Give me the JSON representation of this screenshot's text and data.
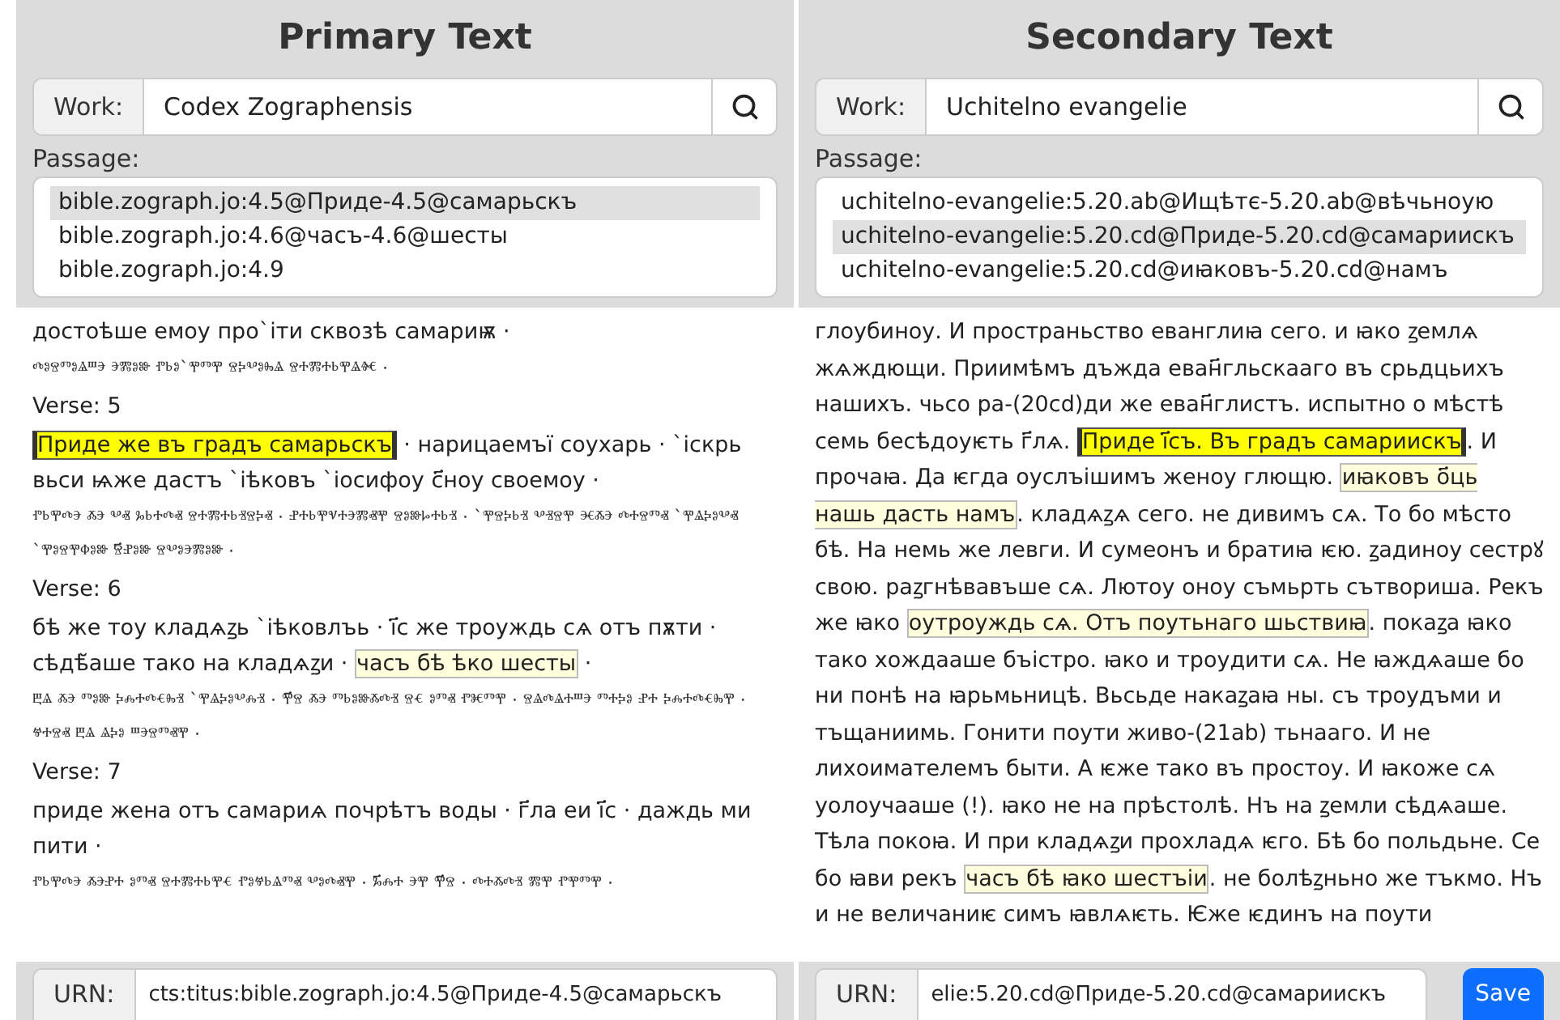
{
  "panels": [
    {
      "title": "Primary Text",
      "work": {
        "label": "Work:",
        "value": "Codex Zographensis"
      },
      "passage": {
        "label": "Passage:",
        "options": [
          {
            "text": "bible.zograph.jo:4.5@Приде-4.5@самарьскъ",
            "selected": true
          },
          {
            "text": "bible.zograph.jo:4.6@часъ-4.6@шесты",
            "selected": false
          },
          {
            "text": "bible.zograph.jo:4.9",
            "selected": false
          }
        ]
      },
      "content": [
        {
          "kind": "cyrillic",
          "segments": [
            {
              "text": "достоѣше емоу про`іти сквозѣ самариѭ ·",
              "kind": "plain"
            }
          ]
        },
        {
          "kind": "glagolitic",
          "text": "ⰴⱁⱄⱅⱁⱑⱎⰵ ⰵⰿⱁⱆ ⱂⱃⱁ`ⰹⱅⰹ ⱄⰽⰲⱁⰸⱑ ⱄⰰⰿⰰⱃⰹⱑⱙ ·"
        },
        {
          "kind": "verse_label",
          "text": "Verse: 5"
        },
        {
          "kind": "cyrillic",
          "segments": [
            {
              "text": "Приде же въ градъ самарьскъ",
              "kind": "strong"
            },
            {
              "text": " · нарицаемъї соухарь · ˋіскрь вьси ѩже дастъ ˋіѣковъ ˋіосифоу с҃ноу своемоу ·",
              "kind": "plain"
            }
          ]
        },
        {
          "kind": "glagolitic",
          "text": "ⱂⱃⰹⰴⰵ ⰶⰵ ⰲⱏ ⰳⱃⰰⰴⱏ ⱄⰰⰿⰰⱃⱐⱄⰽⱏ · ⱀⰰⱃⰹⱌⰰⰵⰿⱏⰹ ⱄⱁⱆⱈⰰⱃⱐ · ˋⰹⱄⰽⱃⱐ ⰲⱐⱄⰹ ⱗⰶⰵ ⰴⰰⱄⱅⱏ ˋⰹⱑⰽⱁⰲⱏ ˋⰹⱁⱄⰹⱇⱁⱆ ⱄ҃ⱀⱁⱆ ⱄⰲⱁⰵⰿⱁⱆ ·"
        },
        {
          "kind": "verse_label",
          "text": "Verse: 6"
        },
        {
          "kind": "cyrillic",
          "segments": [
            {
              "text": "бѣ же тоу кладѧꙁь ˋіѣковлъь · і҃с же троуждь сѧ отъ пѫти · сѣдѣ̆аше тако на кладѧꙁи · ",
              "kind": "plain"
            },
            {
              "text": "часъ бѣ ѣко шесты",
              "kind": "light"
            },
            {
              "text": " ·",
              "kind": "plain"
            }
          ]
        },
        {
          "kind": "glagolitic",
          "text": "ⰱⱑ ⰶⰵ ⱅⱁⱆ ⰽⰾⰰⰴⱔⰸⱐ ˋⰹⱑⰽⱁⰲⰾⱐ · ⰹ҃ⱄ ⰶⰵ ⱅⱃⱁⱆⰶⰴⱐ ⱄⱔ ⱁⱅⱏ ⱂⱘⱅⰹ · ⱄⱑⰴⱑⰰⱎⰵ ⱅⰰⰽⱁ ⱀⰰ ⰽⰾⰰⰴⱔⰸⰹ · ⱍⰰⱄⱏ ⰱⱑ ⱑⰽⱁ ⱎⰵⱄⱅⱏⰹ ·"
        },
        {
          "kind": "verse_label",
          "text": "Verse: 7"
        },
        {
          "kind": "cyrillic",
          "segments": [
            {
              "text": "приде жена отъ самариѧ почрѣтъ воды · г҃ла еи і҃с · даждь ми пити ·",
              "kind": "plain"
            }
          ]
        },
        {
          "kind": "glagolitic",
          "text": "ⱂⱃⰹⰴⰵ ⰶⰵⱀⰰ ⱁⱅⱏ ⱄⰰⰿⰰⱃⰹⱔ ⱂⱁⱍⱃⱑⱅⱏ ⰲⱁⰴⱏⰹ · ⰳ҃ⰾⰰ ⰵⰹ ⰹ҃ⱄ · ⰴⰰⰶⰴⱐ ⰿⰹ ⱂⰹⱅⰹ ·"
        }
      ],
      "urn": {
        "label": "URN:",
        "value": "cts:titus:bible.zograph.jo:4.5@Приде-4.5@самарьскъ"
      }
    },
    {
      "title": "Secondary Text",
      "work": {
        "label": "Work:",
        "value": "Uchitelno evangelie"
      },
      "passage": {
        "label": "Passage:",
        "options": [
          {
            "text": "uchitelno-evangelie:5.20.ab@Ищѣтє-5.20.ab@вѣчьноую",
            "selected": false
          },
          {
            "text": "uchitelno-evangelie:5.20.cd@Приде-5.20.cd@самариискъ",
            "selected": true
          },
          {
            "text": "uchitelno-evangelie:5.20.cd@иꙗковъ-5.20.cd@намъ",
            "selected": false
          }
        ]
      },
      "content": [
        {
          "kind": "cyrillic",
          "segments": [
            {
              "text": "глоубиноу. И пространьство еванглиꙗ сего. и ꙗко ꙁемлѧ жѧждющи. Приимѣмъ дъжда еван҃гльскааго въ срьдцьихъ нашихъ. чьсо ра-(20cd)ди же еван҃глистъ. испытно о мѣстѣ семь бесѣдоуѥть г҃лѧ. ",
              "kind": "plain"
            },
            {
              "text": "Приде і҃съ. Въ градъ самариискъ",
              "kind": "strong"
            },
            {
              "text": ". И прочаꙗ. Да ѥгда оуслъішимъ женоу глющю. ",
              "kind": "plain"
            },
            {
              "text": "иꙗковъ о҃ць нашь дасть намъ",
              "kind": "light"
            },
            {
              "text": ". кладѧꙁѧ сего. не дивимъ сѧ. То бо мѣсто бѣ. На немь же левги. И сумеонъ и братиꙗ ѥю. ꙁадиноу сестрꙋ свою. раꙁгнѣвавъше сѧ. Лютоу оноу съмьрть сътвориша. Рекъ же ꙗко ",
              "kind": "plain"
            },
            {
              "text": "оутроуждь сѧ. Отъ поутьнаго шьствиꙗ",
              "kind": "light"
            },
            {
              "text": ". покаꙁа ꙗко тако хождааше бъістро. ꙗко и троудити сѧ. Не ꙗждѧаше бо ни понѣ на ꙗрьмьницѣ. Вьсьде накаꙁаꙗ ны. съ троудъми и тъщаниимь. Гонити поути живо-(21ab) тьнааго. И не лихоимателемъ быти. А ѥже тако въ простоу. И ꙗкоже сѧ уолоучааше (!). ꙗко не на прѣстолѣ. Нъ на ꙁемли сѣдѧаше. Тѣла покоꙗ. И при кладѧꙁи прохладѧ ѥго. Бѣ бо польдьне. Се бо ꙗви рекъ ",
              "kind": "plain"
            },
            {
              "text": "часъ бѣ ꙗко шестъіи",
              "kind": "light"
            },
            {
              "text": ". не болѣꙁньно же тъкмо. Нъ и не величаниѥ симъ ꙗвлѧѥть. Ѥже ѥдинъ на поути",
              "kind": "plain"
            }
          ]
        }
      ],
      "urn": {
        "label": "URN:",
        "value": "elie:5.20.cd@Приде-5.20.cd@самариискъ"
      },
      "save_button": "Save"
    }
  ]
}
